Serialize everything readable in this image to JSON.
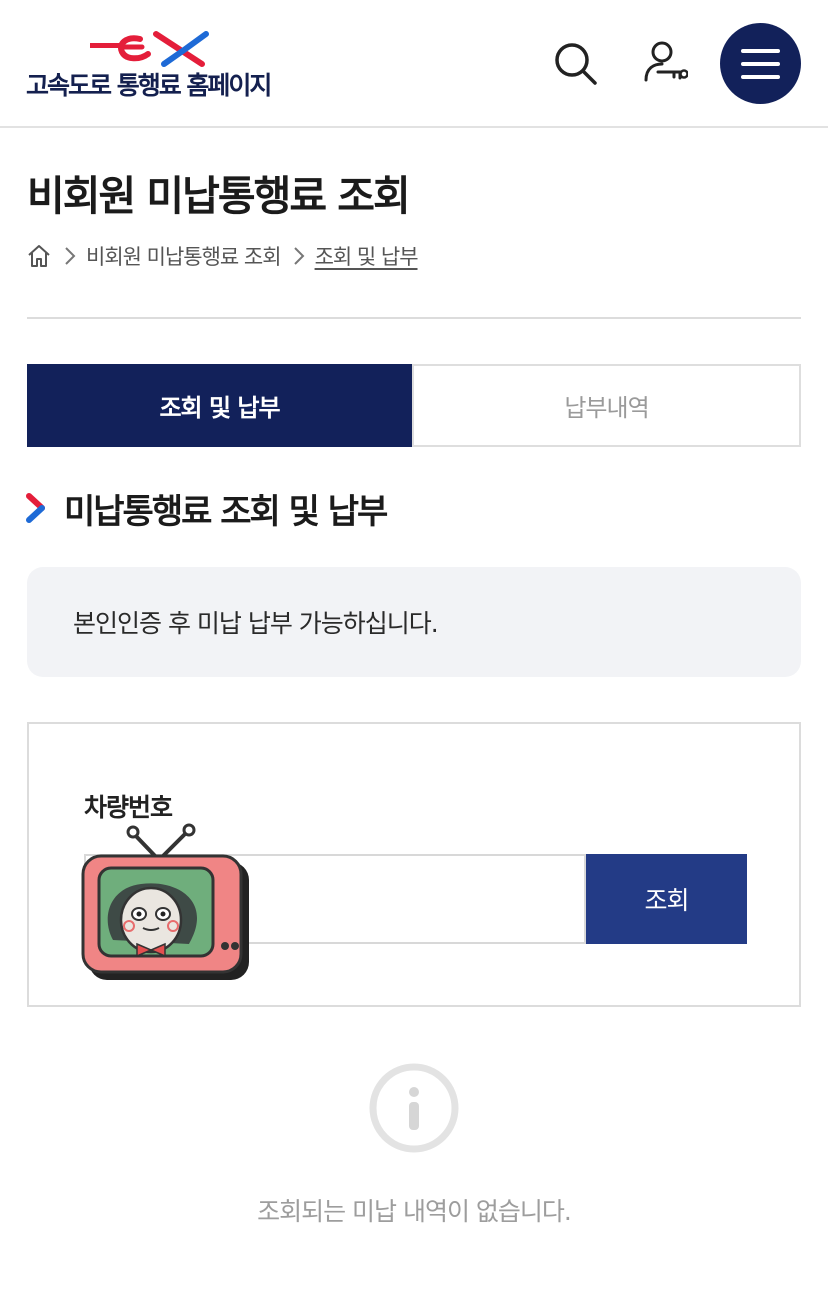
{
  "header": {
    "logo_mark": "ex",
    "logo_text": "고속도로 통행료 홈페이지",
    "icons": {
      "search": "search-icon",
      "user": "user-key-icon",
      "menu": "hamburger-menu-icon"
    },
    "brand_color": "#12215a"
  },
  "page": {
    "title": "비회원 미납통행료 조회"
  },
  "breadcrumb": {
    "home_icon": "home-icon",
    "items": [
      "비회원 미납통행료 조회",
      "조회 및 납부"
    ]
  },
  "tabs": [
    {
      "label": "조회 및 납부",
      "active": true
    },
    {
      "label": "납부내역",
      "active": false
    }
  ],
  "section": {
    "title": "미납통행료 조회 및 납부"
  },
  "notice": {
    "text": "본인인증 후 미납 납부 가능하십니다."
  },
  "form": {
    "plate_label": "차량번호",
    "plate_value": "",
    "plate_placeholder": "",
    "submit_label": "조회",
    "button_color": "#233b86"
  },
  "empty_state": {
    "icon": "info-icon",
    "message": "조회되는 미납 내역이 없습니다."
  }
}
